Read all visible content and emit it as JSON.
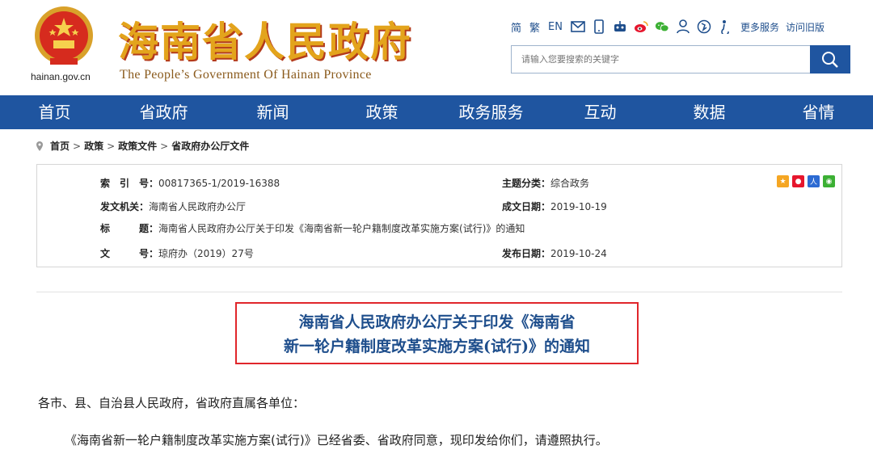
{
  "header": {
    "domain": "hainan.gov.cn",
    "title": "海南省人民政府",
    "subtitle": "The People’s Government Of Hainan Province",
    "lang": [
      "简",
      "繁",
      "EN"
    ],
    "icons": [
      "mail-icon",
      "mobile-icon",
      "robot-icon",
      "weibo-icon",
      "wechat-icon",
      "person-icon",
      "accessibility-icon",
      "elderly-icon"
    ],
    "more_services": "更多服务",
    "old_version": "访问旧版",
    "search_placeholder": "请输入您要搜索的关键字"
  },
  "nav": [
    "首页",
    "省政府",
    "新闻",
    "政策",
    "政务服务",
    "互动",
    "数据",
    "省情"
  ],
  "breadcrumb": [
    "首页",
    "政策",
    "政策文件",
    "省政府办公厅文件"
  ],
  "info": {
    "index_label": "索　引　号：",
    "index_value": "00817365-1/2019-16388",
    "category_label": "主题分类：",
    "category_value": "综合政务",
    "issuer_label": "发文机关：",
    "issuer_value": "海南省人民政府办公厅",
    "created_label": "成文日期：",
    "created_value": "2019-10-19",
    "title_label": "标　　　题：",
    "title_value": "海南省人民政府办公厅关于印发《海南省新一轮户籍制度改革实施方案(试行)》的通知",
    "docno_label": "文　　　号：",
    "docno_value": "琼府办（2019）27号",
    "published_label": "发布日期：",
    "published_value": "2019-10-24"
  },
  "article": {
    "title_line1": "海南省人民政府办公厅关于印发《海南省",
    "title_line2": "新一轮户籍制度改革实施方案(试行)》的通知",
    "salutation": "各市、县、自治县人民政府，省政府直属各单位：",
    "para1": "《海南省新一轮户籍制度改革实施方案(试行)》已经省委、省政府同意，现印发给你们，请遵照执行。"
  }
}
